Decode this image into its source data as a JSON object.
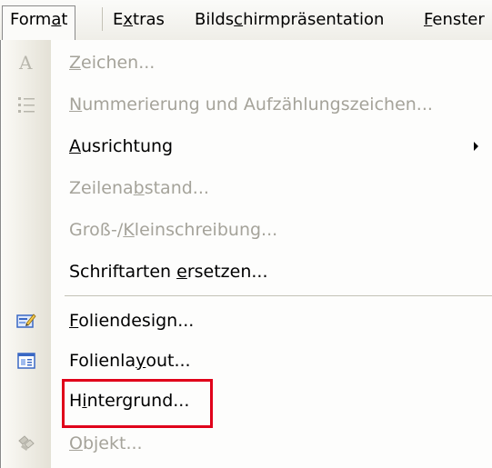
{
  "menubar": {
    "items": [
      {
        "pre": "Form",
        "u": "a",
        "post": "t"
      },
      {
        "pre": "E",
        "u": "x",
        "post": "tras"
      },
      {
        "pre": "Bilds",
        "u": "c",
        "post": "hirmpräsentation"
      },
      {
        "pre": "",
        "u": "F",
        "post": "enster"
      }
    ]
  },
  "menu": {
    "items": [
      {
        "pre": "",
        "u": "Z",
        "post": "eichen...",
        "disabled": true,
        "icon": "letter-a-icon"
      },
      {
        "pre": "",
        "u": "N",
        "post": "ummerierung und Aufzählungszeichen...",
        "disabled": true,
        "icon": "bullet-list-icon"
      },
      {
        "pre": "",
        "u": "A",
        "post": "usrichtung",
        "disabled": false,
        "submenu": true
      },
      {
        "pre": "Zeilena",
        "u": "b",
        "post": "stand...",
        "disabled": true
      },
      {
        "pre": "Groß-/",
        "u": "K",
        "post": "leinschreibung...",
        "disabled": true
      },
      {
        "pre": "Schriftarten ",
        "u": "e",
        "post": "rsetzen...",
        "disabled": false
      },
      {
        "pre": "",
        "u": "F",
        "post": "oliendesign...",
        "disabled": false,
        "icon": "slide-design-icon"
      },
      {
        "pre": "Folienla",
        "u": "y",
        "post": "out...",
        "disabled": false,
        "icon": "slide-layout-icon"
      },
      {
        "pre": "H",
        "u": "i",
        "post": "ntergrund...",
        "disabled": false,
        "highlighted": true
      },
      {
        "pre": "",
        "u": "O",
        "post": "bjekt...",
        "disabled": true,
        "icon": "object-icon"
      }
    ]
  },
  "colors": {
    "highlight_border": "#e0001a",
    "disabled_text": "#a5a39a",
    "gutter_start": "#fbfaf6",
    "gutter_end": "#e4e1d6"
  }
}
